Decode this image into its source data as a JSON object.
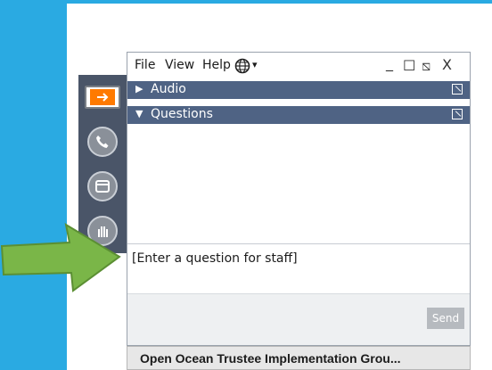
{
  "menu": {
    "file": "File",
    "view": "View",
    "help": "Help",
    "globe_icon": "globe-icon",
    "dropdown_caret": "▾"
  },
  "window_controls": {
    "minimize": "_",
    "maximize": "☐",
    "popout": "⧅",
    "close": "X"
  },
  "sections": [
    {
      "label": "Audio",
      "expanded": false
    },
    {
      "label": "Questions",
      "expanded": true
    }
  ],
  "question_input": {
    "placeholder": "[Enter a question for staff]"
  },
  "send_button": {
    "label": "Send"
  },
  "footer": {
    "title": "Open Ocean Trustee Implementation Grou..."
  },
  "colors": {
    "background": "#2aaae2",
    "section_header": "#4f6384",
    "rail": "#4a5568",
    "arrow": "#7ab648",
    "accent_orange": "#ff7a00"
  }
}
